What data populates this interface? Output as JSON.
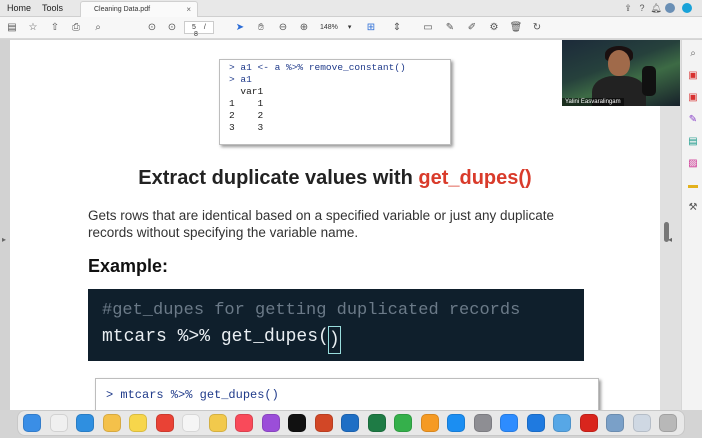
{
  "tabs": {
    "home": "Home",
    "tools": "Tools",
    "document": "Cleaning Data.pdf",
    "close": "×"
  },
  "toolbar": {
    "page_current": "5",
    "page_sep": "/",
    "page_total": "8",
    "zoom": "148%"
  },
  "webcam": {
    "name": "Yalini Easvaralingam"
  },
  "slide": {
    "code_block_1": [
      "> a1 <- a %>% remove_constant()",
      "> a1",
      "  var1",
      "1    1",
      "2    2",
      "3    3"
    ],
    "heading_prefix": "Extract duplicate values with ",
    "heading_function": "get_dupes()",
    "paragraph": "Gets rows that are identical based on a specified variable or just any duplicate records without specifying the variable name.",
    "example_label": "Example:",
    "dark_code_comment": "#get_dupes for getting duplicated records",
    "dark_code_line": "mtcars %>% get_dupes(",
    "dark_code_close": ")",
    "code_block_2": "> mtcars %>% get_dupes()"
  },
  "colors": {
    "accent_red": "#d93b2b",
    "code_bg": "#0f1f2c",
    "primary_blue": "#2a6cd6"
  },
  "dock_apps": [
    "finder",
    "launchpad",
    "safari",
    "photos",
    "notes",
    "chrome",
    "reminders",
    "files",
    "music",
    "podcasts",
    "tv",
    "powerpoint",
    "outlook",
    "excel",
    "numbers",
    "pages",
    "appstore",
    "settings",
    "zoom",
    "keynote",
    "preview",
    "acrobat",
    "r",
    "finder-window",
    "trash"
  ]
}
